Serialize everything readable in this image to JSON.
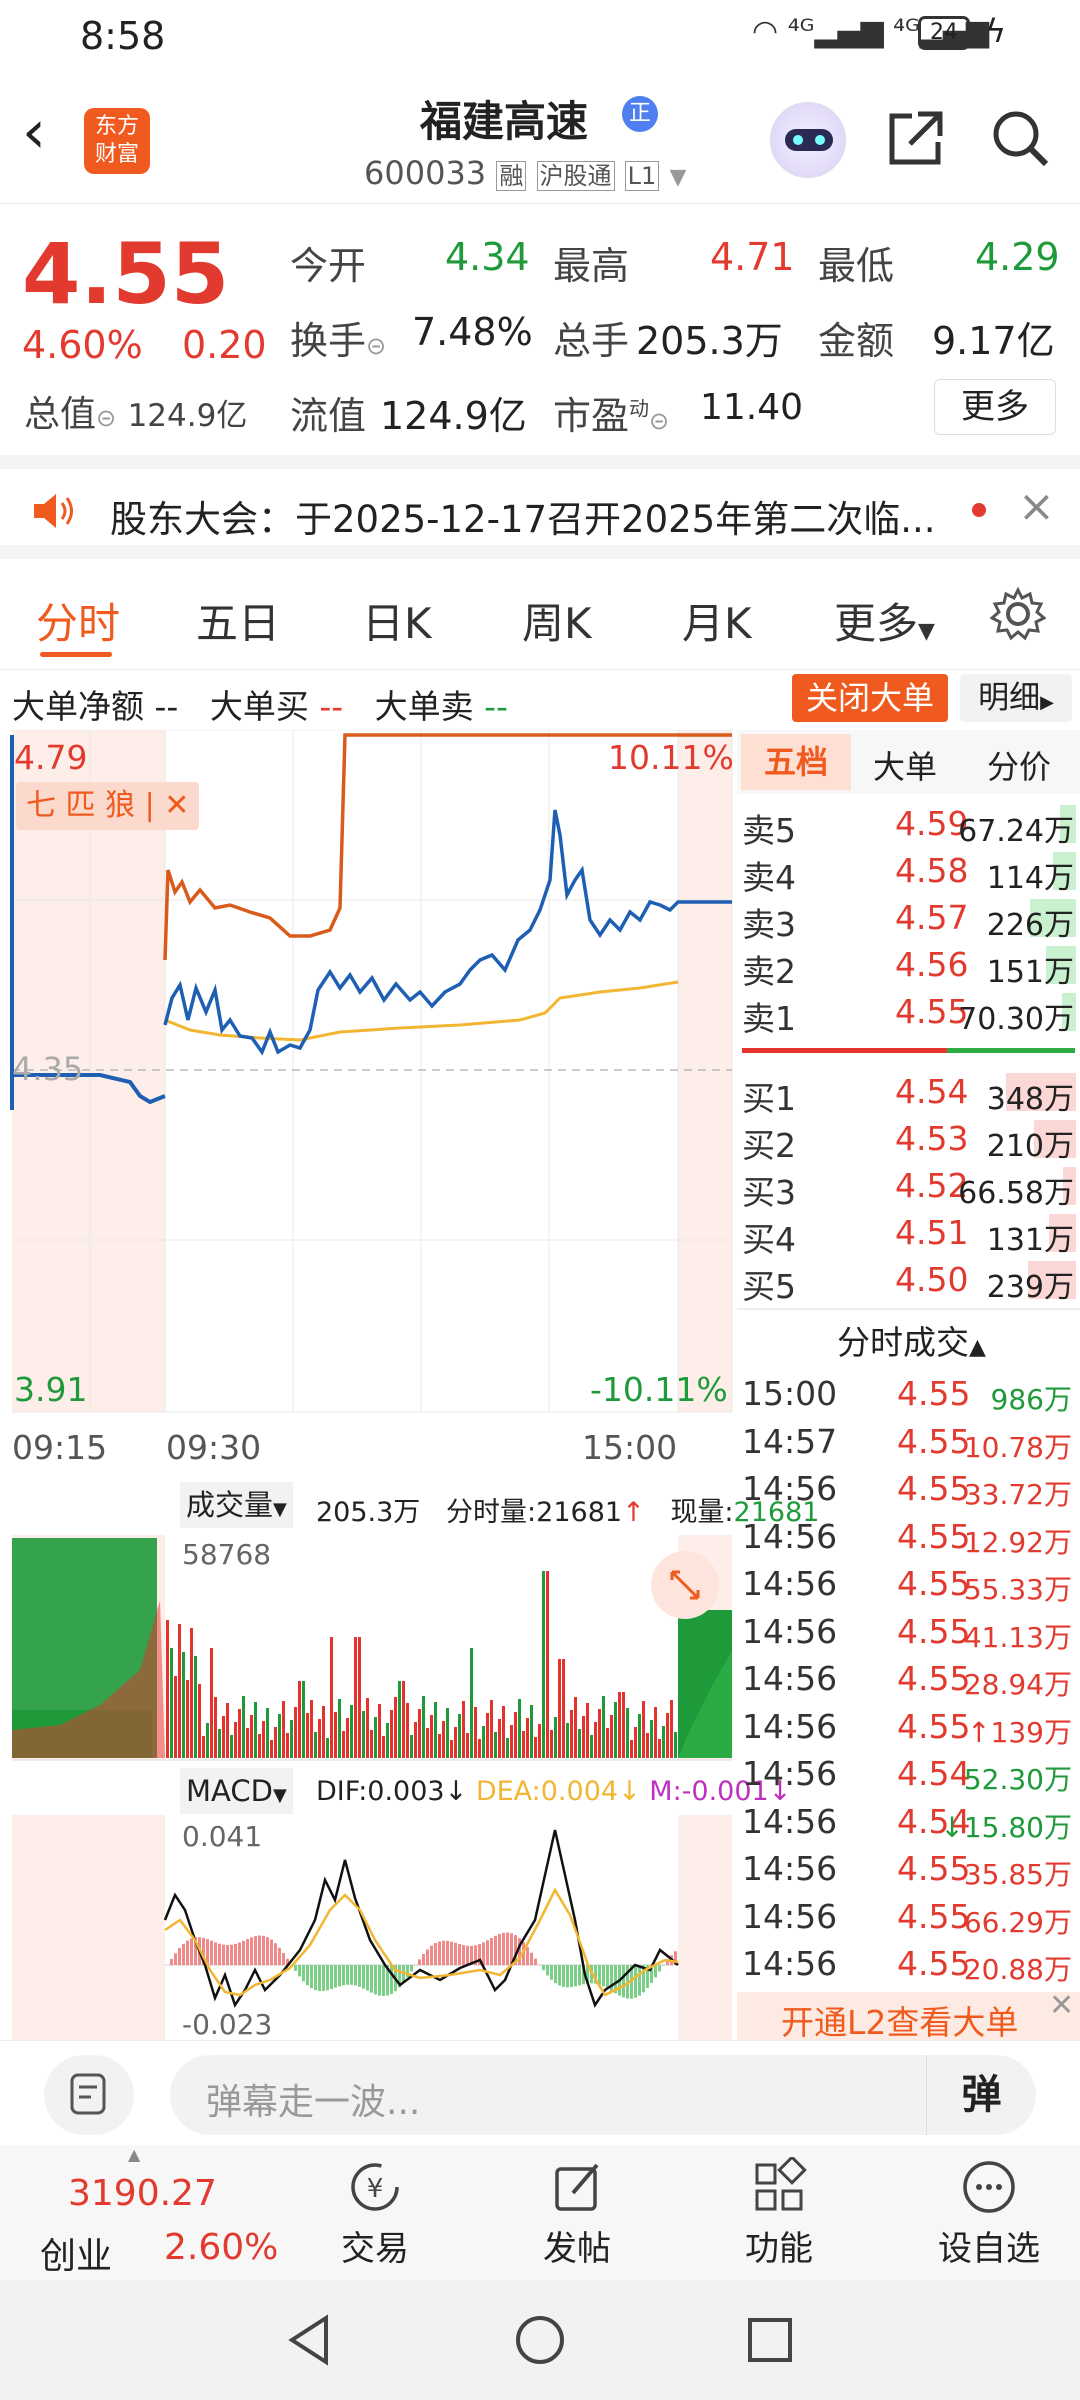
{
  "status": {
    "time": "8:58",
    "battery": "24"
  },
  "header": {
    "logo_line1": "东方",
    "logo_line2": "财富",
    "title": "福建高速",
    "badge": "正",
    "code": "600033",
    "tag1": "融",
    "tag2": "沪股通",
    "tag3": "L1"
  },
  "quote": {
    "price": "4.55",
    "pct": "4.60%",
    "change": "0.20",
    "open_label": "今开",
    "open": "4.34",
    "high_label": "最高",
    "high": "4.71",
    "low_label": "最低",
    "low": "4.29",
    "turnover_label": "换手",
    "turnover": "7.48%",
    "volume_label": "总手",
    "volume": "205.3万",
    "amount_label": "金额",
    "amount": "9.17亿",
    "mcap_label": "总值",
    "mcap": "124.9亿",
    "float_label": "流值",
    "float": "124.9亿",
    "pe_label": "市盈",
    "pe_sup": "动",
    "pe": "11.40",
    "more": "更多"
  },
  "notice": {
    "text": "股东大会：于2025-12-17召开2025年第二次临..."
  },
  "tabs": [
    "分时",
    "五日",
    "日K",
    "周K",
    "月K",
    "更多"
  ],
  "bigorder": {
    "net_label": "大单净额",
    "net": "--",
    "buy_label": "大单买",
    "buy": "--",
    "sell_label": "大单卖",
    "sell": "--",
    "close_btn": "关闭大单",
    "detail_btn": "明细"
  },
  "chart": {
    "ymax": "4.79",
    "ymin": "3.91",
    "pct_max": "10.11%",
    "pct_min": "-10.11%",
    "prev_close": "4.35",
    "indicator_tag": "七 匹 狼 |",
    "t1": "09:15",
    "t2": "09:30",
    "t3": "15:00",
    "vol_label": "成交量",
    "vol_total": "205.3万",
    "vol_min_label": "分时量:",
    "vol_min": "21681",
    "vol_cur_label": "现量:",
    "vol_cur": "21681",
    "vol_max": "58768",
    "macd_label": "MACD",
    "dif": "DIF:0.003",
    "dea": "DEA:0.004",
    "m": "M:-0.001",
    "macd_max": "0.041",
    "macd_min": "-0.023"
  },
  "book_tabs": [
    "五档",
    "大单",
    "分价"
  ],
  "asks": [
    {
      "label": "卖5",
      "price": "4.59",
      "vol": "67.24万",
      "ratio": 0.23
    },
    {
      "label": "卖4",
      "price": "4.58",
      "vol": "114万",
      "ratio": 0.33
    },
    {
      "label": "卖3",
      "price": "4.57",
      "vol": "226万",
      "ratio": 0.65
    },
    {
      "label": "卖2",
      "price": "4.56",
      "vol": "151万",
      "ratio": 0.43
    },
    {
      "label": "卖1",
      "price": "4.55",
      "vol": "70.30万",
      "ratio": 0.2
    }
  ],
  "bids": [
    {
      "label": "买1",
      "price": "4.54",
      "vol": "348万",
      "ratio": 1.0
    },
    {
      "label": "买2",
      "price": "4.53",
      "vol": "210万",
      "ratio": 0.6
    },
    {
      "label": "买3",
      "price": "4.52",
      "vol": "66.58万",
      "ratio": 0.19
    },
    {
      "label": "买4",
      "price": "4.51",
      "vol": "131万",
      "ratio": 0.38
    },
    {
      "label": "买5",
      "price": "4.50",
      "vol": "239万",
      "ratio": 0.69
    }
  ],
  "trades_title": "分时成交",
  "trades": [
    {
      "t": "15:00",
      "p": "4.55",
      "v": "986万",
      "c": "green",
      "a": ""
    },
    {
      "t": "14:57",
      "p": "4.55",
      "v": "10.78万",
      "c": "red",
      "a": ""
    },
    {
      "t": "14:56",
      "p": "4.55",
      "v": "33.72万",
      "c": "red",
      "a": ""
    },
    {
      "t": "14:56",
      "p": "4.55",
      "v": "12.92万",
      "c": "red",
      "a": ""
    },
    {
      "t": "14:56",
      "p": "4.55",
      "v": "55.33万",
      "c": "red",
      "a": ""
    },
    {
      "t": "14:56",
      "p": "4.55",
      "v": "41.13万",
      "c": "red",
      "a": ""
    },
    {
      "t": "14:56",
      "p": "4.55",
      "v": "28.94万",
      "c": "red",
      "a": ""
    },
    {
      "t": "14:56",
      "p": "4.55",
      "v": "139万",
      "c": "red",
      "a": "↑"
    },
    {
      "t": "14:56",
      "p": "4.54",
      "v": "52.30万",
      "c": "green",
      "a": ""
    },
    {
      "t": "14:56",
      "p": "4.54",
      "v": "15.80万",
      "c": "green",
      "a": "↓"
    },
    {
      "t": "14:56",
      "p": "4.55",
      "v": "35.85万",
      "c": "red",
      "a": ""
    },
    {
      "t": "14:56",
      "p": "4.55",
      "v": "66.29万",
      "c": "red",
      "a": ""
    },
    {
      "t": "14:56",
      "p": "4.55",
      "v": "20.88万",
      "c": "red",
      "a": ""
    }
  ],
  "l2_banner": "开通L2查看大单",
  "danmu": {
    "placeholder": "弹幕走一波...",
    "btn": "弹"
  },
  "tabbar": {
    "index_value": "3190.27",
    "index_name": "创业",
    "index_pct": "2.60%",
    "items": [
      "交易",
      "发帖",
      "功能",
      "设自选"
    ]
  }
}
